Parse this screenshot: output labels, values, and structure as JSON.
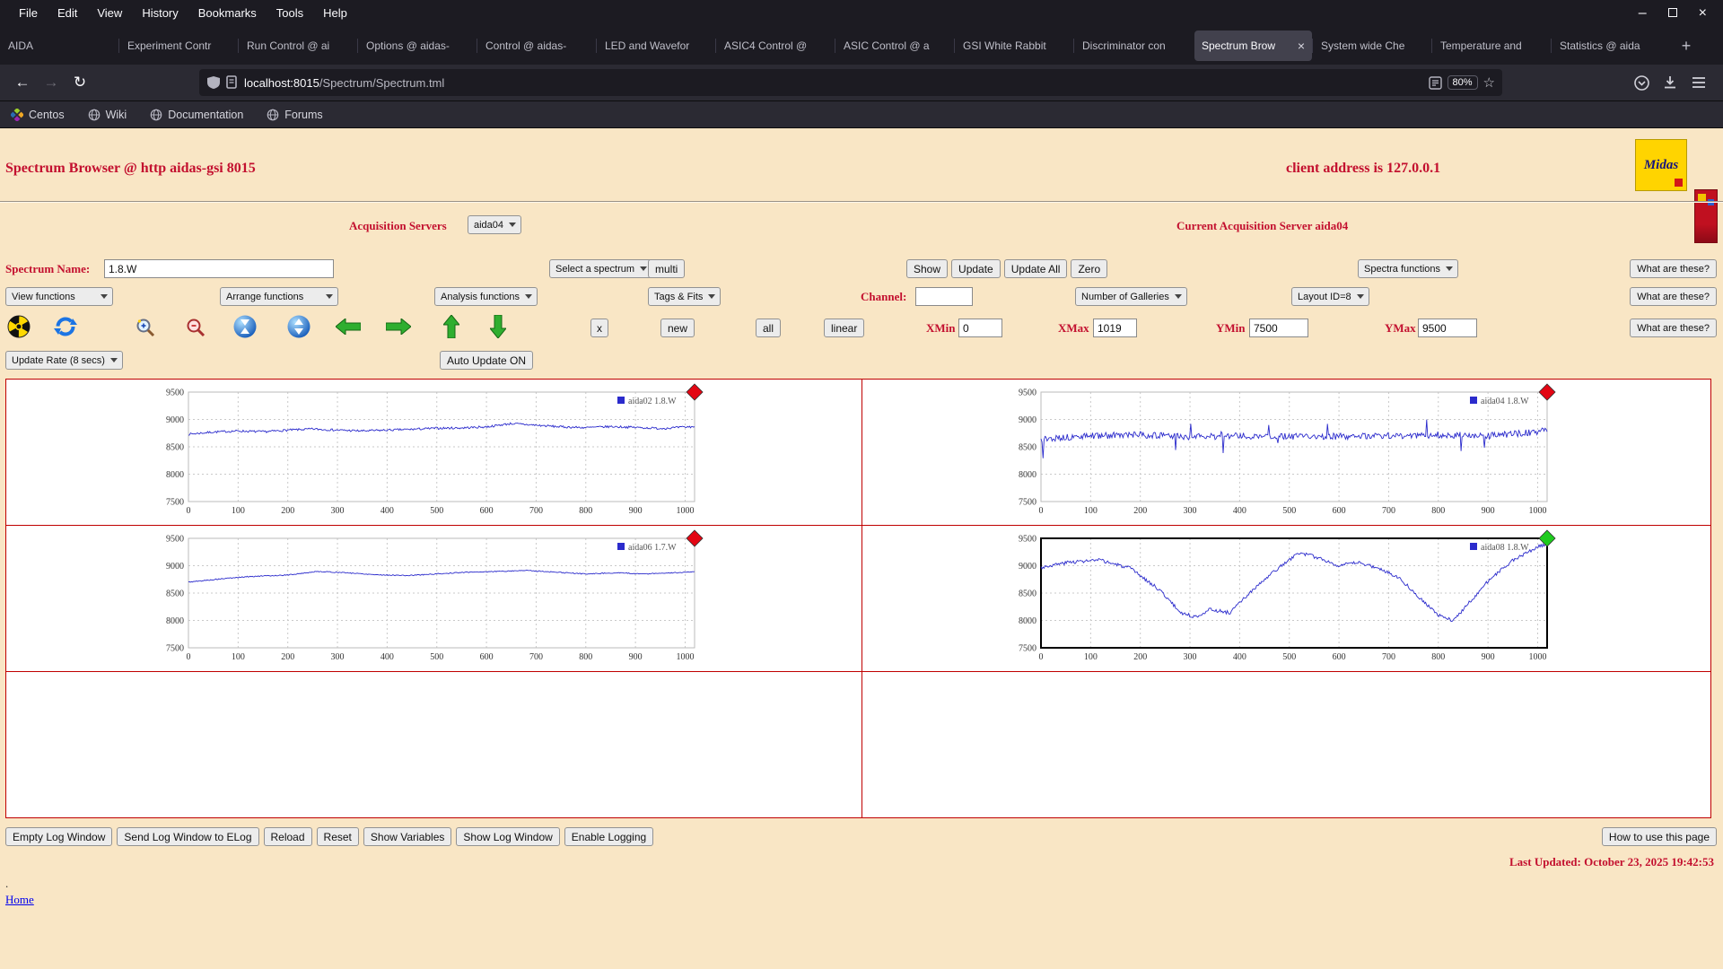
{
  "theme": {
    "accent_red": "#c3102f",
    "grid_border_red": "#c00000",
    "page_background": "#f9e6c5",
    "chart_line_blue": "#2b2bcc",
    "marker_red": "#e30613",
    "marker_green": "#1ecb1e"
  },
  "browser": {
    "menu_items": [
      "File",
      "Edit",
      "View",
      "History",
      "Bookmarks",
      "Tools",
      "Help"
    ],
    "window_controls": {
      "minimize": "–",
      "close": "×"
    },
    "tabs": [
      {
        "label": "AIDA",
        "active": false
      },
      {
        "label": "Experiment Contr",
        "active": false
      },
      {
        "label": "Run Control @ ai",
        "active": false
      },
      {
        "label": "Options @ aidas-",
        "active": false
      },
      {
        "label": "Control @ aidas-",
        "active": false
      },
      {
        "label": "LED and Wavefor",
        "active": false
      },
      {
        "label": "ASIC4 Control @",
        "active": false
      },
      {
        "label": "ASIC Control @ a",
        "active": false
      },
      {
        "label": "GSI White Rabbit",
        "active": false
      },
      {
        "label": "Discriminator con",
        "active": false
      },
      {
        "label": "Spectrum Brow",
        "active": true,
        "close": "×"
      },
      {
        "label": "System wide Che",
        "active": false
      },
      {
        "label": "Temperature and",
        "active": false
      },
      {
        "label": "Statistics @ aida",
        "active": false
      }
    ],
    "new_tab_label": "+",
    "nav": {
      "back": "←",
      "forward": "→",
      "reload": "↻"
    },
    "url": {
      "host": "localhost:8015",
      "path": "/Spectrum/Spectrum.tml",
      "zoom": "80%",
      "star": "☆"
    },
    "bookmarks": [
      {
        "label": "Centos",
        "icon": "centos-icon"
      },
      {
        "label": "Wiki",
        "icon": "globe-icon"
      },
      {
        "label": "Documentation",
        "icon": "globe-icon"
      },
      {
        "label": "Forums",
        "icon": "globe-icon"
      }
    ]
  },
  "page": {
    "title": "Spectrum Browser @ http aidas-gsi 8015",
    "client_address": "client address is 127.0.0.1",
    "logos": {
      "midas": "Midas"
    },
    "acquisition": {
      "label": "Acquisition Servers",
      "server": "aida04",
      "current": "Current Acquisition Server aida04"
    },
    "spectrum_row": {
      "name_label": "Spectrum Name:",
      "name_value": "1.8.W",
      "select_spectrum": "Select a spectrum",
      "multi": "multi",
      "show": "Show",
      "update": "Update",
      "update_all": "Update All",
      "zero": "Zero",
      "spectra_functions": "Spectra functions",
      "what": "What are these?"
    },
    "function_row": {
      "view": "View functions",
      "arrange": "Arrange functions",
      "analysis": "Analysis functions",
      "tags": "Tags & Fits",
      "channel_label": "Channel:",
      "channel_value": "",
      "galleries": "Number of Galleries",
      "layout": "Layout ID=8",
      "what": "What are these?"
    },
    "toolbar": {
      "icons": [
        "radiation-icon",
        "refresh-icon",
        "zoom-in-icon",
        "zoom-out-icon",
        "compress-y-icon",
        "expand-y-icon",
        "pan-left-icon",
        "pan-right-icon",
        "pan-up-icon",
        "pan-down-icon"
      ],
      "x": "x",
      "new": "new",
      "all": "all",
      "linear": "linear",
      "xmin_label": "XMin",
      "xmin": "0",
      "xmax_label": "XMax",
      "xmax": "1019",
      "ymin_label": "YMin",
      "ymin": "7500",
      "ymax_label": "YMax",
      "ymax": "9500",
      "what": "What are these?"
    },
    "update_row": {
      "rate": "Update Rate (8 secs)",
      "auto": "Auto Update ON"
    },
    "footer": {
      "buttons": [
        "Empty Log Window",
        "Send Log Window to ELog",
        "Reload",
        "Reset",
        "Show Variables",
        "Show Log Window",
        "Enable Logging"
      ],
      "help": "How to use this page",
      "last_updated": "Last Updated: October 23, 2025 19:42:53",
      "dot": ".",
      "home": "Home"
    }
  },
  "chart_data": {
    "type": "line",
    "grid": {
      "rows": 3,
      "cols": 2,
      "filled_cells": 4
    },
    "axes": {
      "xlim": [
        0,
        1019
      ],
      "ylim": [
        7500,
        9500
      ],
      "xticks": [
        0,
        100,
        200,
        300,
        400,
        500,
        600,
        700,
        800,
        900,
        1000
      ],
      "yticks": [
        7500,
        8000,
        8500,
        9000,
        9500
      ]
    },
    "charts": [
      {
        "name": "aida02",
        "legend": "aida02 1.8.W",
        "line_color": "#2b2bcc",
        "marker_color": "#e30613",
        "selected": false,
        "noise": 20,
        "seed": 7,
        "points": [
          [
            0,
            8730
          ],
          [
            50,
            8770
          ],
          [
            100,
            8790
          ],
          [
            150,
            8775
          ],
          [
            200,
            8805
          ],
          [
            250,
            8825
          ],
          [
            300,
            8805
          ],
          [
            350,
            8790
          ],
          [
            400,
            8805
          ],
          [
            450,
            8820
          ],
          [
            500,
            8840
          ],
          [
            550,
            8845
          ],
          [
            600,
            8865
          ],
          [
            650,
            8925
          ],
          [
            700,
            8895
          ],
          [
            750,
            8865
          ],
          [
            800,
            8850
          ],
          [
            850,
            8870
          ],
          [
            900,
            8855
          ],
          [
            950,
            8835
          ],
          [
            1019,
            8870
          ]
        ]
      },
      {
        "name": "aida04",
        "legend": "aida04 1.8.W",
        "line_color": "#2b2bcc",
        "marker_color": "#e30613",
        "selected": false,
        "noise": 60,
        "seed": 13,
        "spike_prob": 0.02,
        "spike_amp": 360,
        "points": [
          [
            0,
            8640
          ],
          [
            100,
            8700
          ],
          [
            200,
            8720
          ],
          [
            300,
            8680
          ],
          [
            400,
            8700
          ],
          [
            500,
            8690
          ],
          [
            600,
            8690
          ],
          [
            700,
            8700
          ],
          [
            800,
            8720
          ],
          [
            900,
            8700
          ],
          [
            1019,
            8790
          ]
        ]
      },
      {
        "name": "aida06",
        "legend": "aida06 1.7.W",
        "line_color": "#2b2bcc",
        "marker_color": "#e30613",
        "selected": false,
        "noise": 9,
        "seed": 5,
        "points": [
          [
            0,
            8700
          ],
          [
            60,
            8755
          ],
          [
            120,
            8800
          ],
          [
            200,
            8830
          ],
          [
            260,
            8895
          ],
          [
            320,
            8870
          ],
          [
            380,
            8835
          ],
          [
            440,
            8820
          ],
          [
            500,
            8850
          ],
          [
            560,
            8880
          ],
          [
            620,
            8895
          ],
          [
            680,
            8915
          ],
          [
            740,
            8880
          ],
          [
            800,
            8850
          ],
          [
            860,
            8870
          ],
          [
            920,
            8850
          ],
          [
            1019,
            8885
          ]
        ]
      },
      {
        "name": "aida08",
        "legend": "aida08 1.8.W",
        "line_color": "#2b2bcc",
        "marker_color": "#1ecb1e",
        "selected": true,
        "noise": 32,
        "seed": 3,
        "points": [
          [
            0,
            8970
          ],
          [
            60,
            9070
          ],
          [
            120,
            9100
          ],
          [
            180,
            8950
          ],
          [
            240,
            8550
          ],
          [
            280,
            8150
          ],
          [
            310,
            8060
          ],
          [
            340,
            8200
          ],
          [
            380,
            8140
          ],
          [
            420,
            8500
          ],
          [
            470,
            8900
          ],
          [
            520,
            9240
          ],
          [
            560,
            9140
          ],
          [
            600,
            9000
          ],
          [
            640,
            9060
          ],
          [
            680,
            8950
          ],
          [
            720,
            8790
          ],
          [
            760,
            8440
          ],
          [
            800,
            8090
          ],
          [
            830,
            8000
          ],
          [
            860,
            8300
          ],
          [
            900,
            8720
          ],
          [
            950,
            9100
          ],
          [
            1000,
            9340
          ],
          [
            1019,
            9400
          ]
        ]
      }
    ]
  }
}
